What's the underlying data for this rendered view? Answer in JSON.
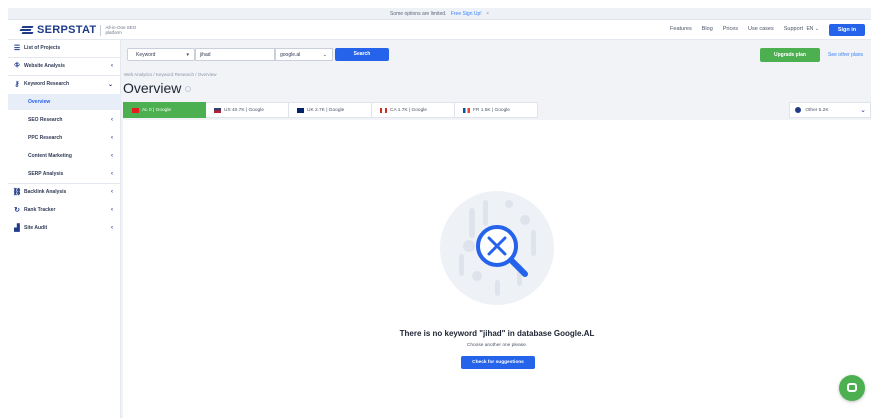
{
  "topbar": {
    "text": "Some options are limited.",
    "link": "Free Sign Up!",
    "close": "×"
  },
  "header": {
    "logo_text": "SERPSTAT",
    "logo_tagline": "All-in-One SEO platform",
    "nav": [
      "Features",
      "Blog",
      "Prices",
      "Use cases",
      "Support"
    ],
    "lang": "EN",
    "signin": "Sign in"
  },
  "sidebar": {
    "projects": "List of Projects",
    "website_analysis": "Website Analysis",
    "keyword_research": "Keyword Research",
    "overview": "Overview",
    "seo_research": "SEO Research",
    "ppc_research": "PPC Research",
    "content_marketing": "Content Marketing",
    "serp_analysis": "SERP Analysis",
    "backlink_analysis": "Backlink Analysis",
    "rank_tracker": "Rank Tracker",
    "site_audit": "Site Audit"
  },
  "search": {
    "mode": "Keyword",
    "query": "jihad",
    "database": "google.al",
    "button": "Search"
  },
  "upgrade": {
    "button": "Upgrade plan",
    "plans_link": "See other plans"
  },
  "breadcrumb": "Web Analytics / Keyword Research / Overview",
  "page_title": "Overview",
  "tabs": [
    {
      "label": "AL 0 | Google",
      "flag_color": "#e41e20"
    },
    {
      "label": "US 40.7K | Google",
      "flag_color": "#3c3b6e"
    },
    {
      "label": "UK 2.7K | Google",
      "flag_color": "#012169"
    },
    {
      "label": "CA 1.7K | Google",
      "flag_color": "#d52b1e"
    },
    {
      "label": "FR 1.5K | Google",
      "flag_color": "#0055a4"
    }
  ],
  "other_databases": "Other 5.2K",
  "empty_state": {
    "title": "There is no keyword \"jihad\" in database Google.AL",
    "subtitle": "Choose another one please.",
    "button": "Check for suggestions"
  },
  "colors": {
    "primary": "#2563eb",
    "success": "#4caf50",
    "brand": "#1f3b8a"
  }
}
